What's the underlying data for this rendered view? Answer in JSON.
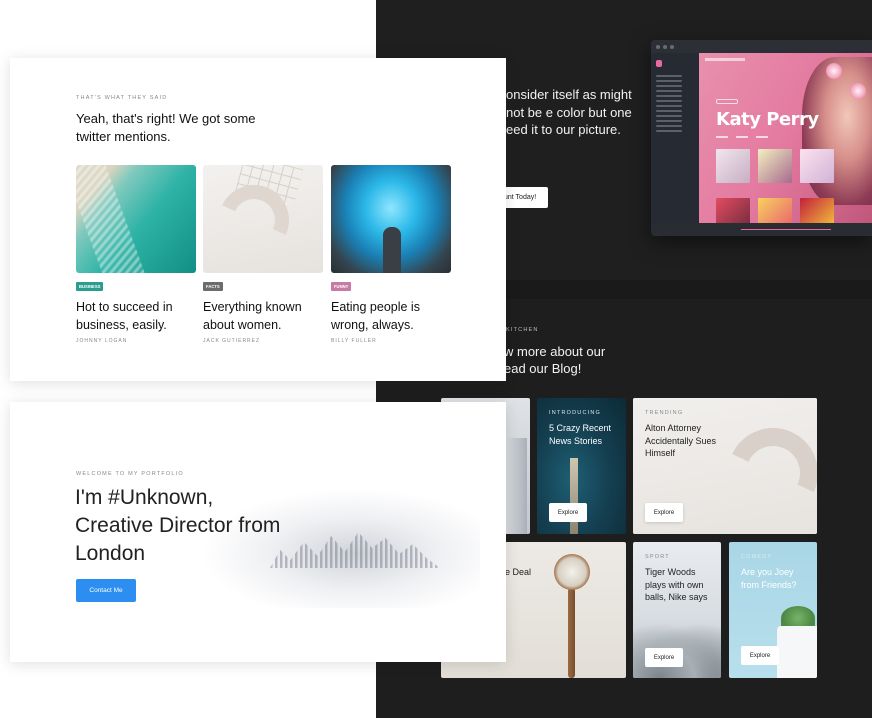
{
  "promo": {
    "text": "onsider itself as might not be e color but one eed it to our picture.",
    "button_label": "unt Today!"
  },
  "music_app": {
    "artist_name": "Katy Perry"
  },
  "blog": {
    "eyebrow": "KITCHEN",
    "heading": "w more about our ead our Blog!",
    "tiles": [
      {
        "tag": "INTRODUCING",
        "title": "5 Crazy Recent News Stories",
        "button": "Explore"
      },
      {
        "tag": "TRENDING",
        "title": "Alton Attorney Accidentally Sues Himself",
        "button": "Explore"
      },
      {
        "tag": "",
        "title": "e Deal",
        "button": ""
      },
      {
        "tag": "SPORT",
        "title": "Tiger Woods plays with own balls, Nike says",
        "button": "Explore"
      },
      {
        "tag": "COMEDY",
        "title": "Are you Joey from Friends?",
        "button": "Explore"
      }
    ]
  },
  "testimonials": {
    "eyebrow": "THAT'S WHAT THEY SAID",
    "headline": "Yeah, that's right! We got some twitter mentions.",
    "posts": [
      {
        "badge": "BUSINESS",
        "badge_color": "#2a9d8f",
        "title": "Hot to succeed in business, easily.",
        "author": "JOHNNY LOGAN"
      },
      {
        "badge": "FACTS",
        "badge_color": "#6c6c6c",
        "title": "Everything known about women.",
        "author": "JACK GUTIERREZ"
      },
      {
        "badge": "FUNNY",
        "badge_color": "#c77aa6",
        "title": "Eating people is wrong, always.",
        "author": "BILLY FULLER"
      }
    ]
  },
  "portfolio": {
    "eyebrow": "WELCOME TO MY PORTFOLIO",
    "hero": "I'm #Unknown, Creative Director from London",
    "cta_label": "Contact Me",
    "cta_color": "#2b8ef0"
  }
}
